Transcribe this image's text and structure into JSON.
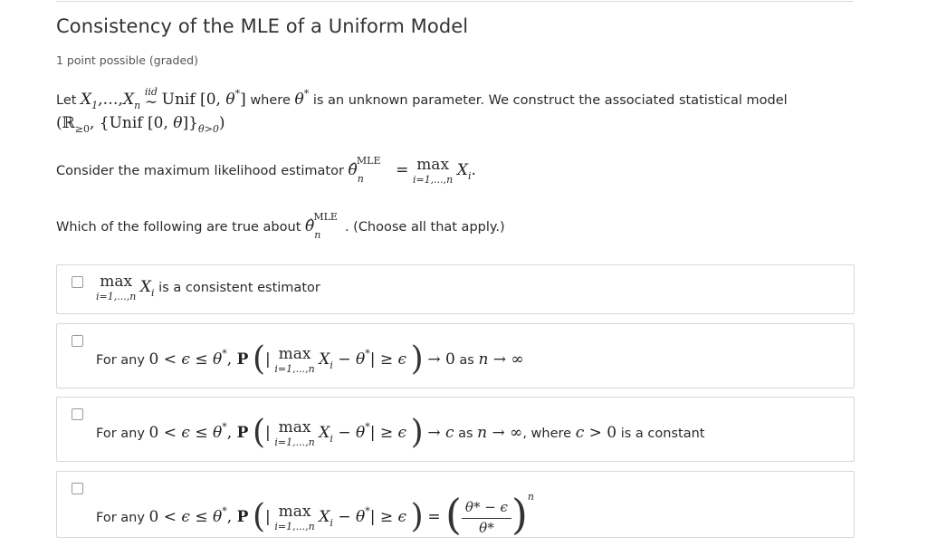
{
  "problem": {
    "title": "Consistency of the MLE of a Uniform Model",
    "points": "1 point possible (graded)"
  },
  "para1": {
    "t1": "Let",
    "t2": "where",
    "t3": "is an unknown parameter. We construct the associated statistical model"
  },
  "para2": {
    "t1": "Consider the maximum likelihood estimator"
  },
  "para3": {
    "t1": "Which of the following are true about",
    "t2": ". (Choose all that apply.)"
  },
  "math": {
    "max": "max",
    "range": "i=1,...,n",
    "mle": "MLE",
    "iid": "iid"
  },
  "options": [
    {
      "label_suffix": "is a consistent estimator"
    },
    {
      "prefix": "For any",
      "suffix_a": "as",
      "suffix_b": ""
    },
    {
      "prefix": "For any",
      "suffix_a": "as",
      "suffix_b": ", where",
      "suffix_c": "is a constant"
    },
    {
      "prefix": "For any"
    }
  ]
}
